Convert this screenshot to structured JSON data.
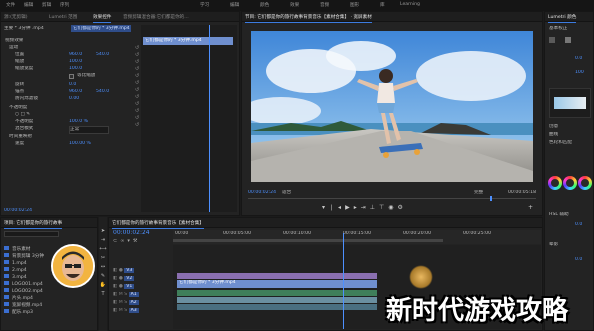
{
  "menu": [
    "文件",
    "编辑",
    "剪辑",
    "序列",
    "标记",
    "图形",
    "视图",
    "窗口",
    "帮助",
    "学习",
    "组件",
    "编辑",
    "颜色",
    "效果",
    "音频",
    "图形",
    "库",
    "Learning"
  ],
  "effect_controls": {
    "tabs": [
      "源:(无剪辑)",
      "Lumetri 范围",
      "效果控件",
      "音频剪辑混合器:它们都是你的..."
    ],
    "source_label": "主要 * 3分钟 .mp4",
    "clip_label": "它们都是你的 * 3分钟.mp4",
    "sections": [
      "视频效果",
      "运动",
      "位置",
      "缩放",
      "缩放宽度",
      "等比缩放",
      "旋转",
      "锚点",
      "防闪烁滤镜",
      "不透明度",
      "混合模式",
      "时间重映射",
      "速度"
    ],
    "values": [
      "960.0",
      "540.0",
      "100.0",
      "100.0",
      "0.0",
      "960.0",
      "540.0",
      "0.00",
      "100.0 %",
      "正常",
      "100.00 %"
    ],
    "timecode": "00:00:02:24"
  },
  "program_monitor": {
    "tab": "节目: 它们都是你的旅行故事背景音乐【素材合集】 · 宽屏素材",
    "timecode_left": "00:00:02:24",
    "fit": "适合",
    "quality": "完整",
    "timecode_right": "00:00:05:18"
  },
  "project": {
    "tab": "项目: 它们都是你的旅行故事",
    "search": "",
    "items": [
      "音乐素材",
      "背景剪辑 3分钟",
      "1.mp4",
      "2.mp4",
      "3.mp4",
      "LOGO01.mp4",
      "LOGO02.mp4",
      "片头.mp4",
      "宽屏视频.mp4",
      "配乐.mp3"
    ]
  },
  "timeline": {
    "tab": "它们都是你的旅行故事背景音乐【素材合集】",
    "timecode": "00:00:02:24",
    "ruler": [
      "00:00",
      "00:00:05:00",
      "00:00:10:00",
      "00:00:15:00",
      "00:00:20:00",
      "00:00:25:00"
    ],
    "video_tracks": [
      "V3",
      "V2",
      "V1"
    ],
    "audio_tracks": [
      "A1",
      "A2",
      "A3"
    ],
    "clip_v1": "它们都是你的 * 3分钟.mp4"
  },
  "lumetri": {
    "tab": "Lumetri 颜色",
    "labels": [
      "基本校正",
      "创意",
      "曲线",
      "色轮和匹配",
      "HSL 辅助",
      "晕影"
    ],
    "values": [
      "0.0",
      "100",
      "0.0",
      "0.0"
    ]
  },
  "watermark": "新时代游戏攻略",
  "colors": {
    "accent": "#4d90ff",
    "clip_video": "#8a6fb0",
    "clip_audio": "#3f7f5a",
    "playhead": "#4d90ff"
  }
}
